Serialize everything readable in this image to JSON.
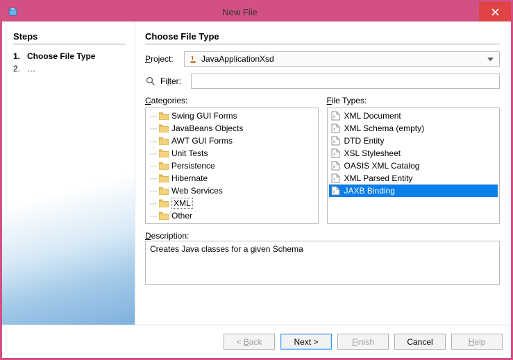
{
  "window": {
    "title": "New File"
  },
  "steps": {
    "heading": "Steps",
    "items": [
      {
        "num": "1.",
        "label": "Choose File Type",
        "current": true
      },
      {
        "num": "2.",
        "label": "…",
        "current": false
      }
    ]
  },
  "main": {
    "heading": "Choose File Type",
    "project_label": "Project:",
    "project_value": "JavaApplicationXsd",
    "filter_label": "Filter:",
    "filter_value": "",
    "categories_label": "Categories:",
    "categories": [
      {
        "label": "Swing GUI Forms",
        "selected": false
      },
      {
        "label": "JavaBeans Objects",
        "selected": false
      },
      {
        "label": "AWT GUI Forms",
        "selected": false
      },
      {
        "label": "Unit Tests",
        "selected": false
      },
      {
        "label": "Persistence",
        "selected": false
      },
      {
        "label": "Hibernate",
        "selected": false
      },
      {
        "label": "Web Services",
        "selected": false
      },
      {
        "label": "XML",
        "selected": true
      },
      {
        "label": "Other",
        "selected": false
      }
    ],
    "filetypes_label": "File Types:",
    "filetypes": [
      {
        "label": "XML Document",
        "selected": false
      },
      {
        "label": "XML Schema (empty)",
        "selected": false
      },
      {
        "label": "DTD Entity",
        "selected": false
      },
      {
        "label": "XSL Stylesheet",
        "selected": false
      },
      {
        "label": "OASIS XML Catalog",
        "selected": false
      },
      {
        "label": "XML Parsed Entity",
        "selected": false
      },
      {
        "label": "JAXB Binding",
        "selected": true
      }
    ],
    "description_label": "Description:",
    "description_value": "Creates Java classes for a given Schema"
  },
  "buttons": {
    "back": "< Back",
    "next": "Next >",
    "finish": "Finish",
    "cancel": "Cancel",
    "help": "Help"
  }
}
